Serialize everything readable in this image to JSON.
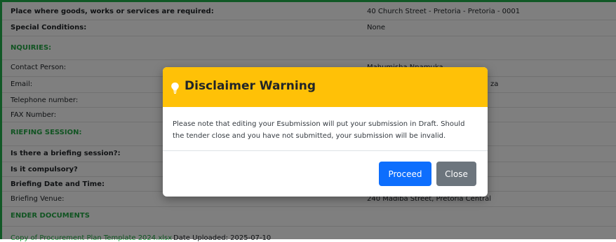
{
  "details": {
    "place_label": "Place where goods, works or services are required:",
    "place_value": "40 Church Street - Pretoria - Pretoria - 0001",
    "special_label": "Special Conditions:",
    "special_value": "None",
    "enquiries_heading": "NQUIRIES:",
    "contact_label": "Contact Person:",
    "contact_value": "Mahumisha Nnamuka",
    "email_label": "Email:",
    "email_value_tail": "za",
    "telephone_label": "Telephone number:",
    "fax_label": "FAX Number:",
    "briefing_heading": "RIEFING SESSION:",
    "briefing_q_label": "Is there a briefing session?:",
    "compulsory_label": "Is it compulsory?",
    "date_label": "Briefing Date and Time:",
    "venue_label": "Briefing Venue:",
    "venue_value": "240 Madiba Street, Pretoria Central",
    "tender_heading": "ENDER DOCUMENTS",
    "doc_link": "Copy of Procurement Plan Template 2024.xlsx",
    "doc_uploaded": "Date Uploaded: 2025-07-10"
  },
  "modal": {
    "icon": "lightbulb-icon",
    "title": "Disclaimer Warning",
    "body": "Please note that editing your Esubmission will put your submission in Draft. Should the tender close and you have not submitted, your submission will be invalid.",
    "proceed_label": "Proceed",
    "close_label": "Close"
  },
  "colors": {
    "header": "#ffc107",
    "proceed": "#0d6efd",
    "close": "#6c757d",
    "section_green": "#22a844"
  }
}
